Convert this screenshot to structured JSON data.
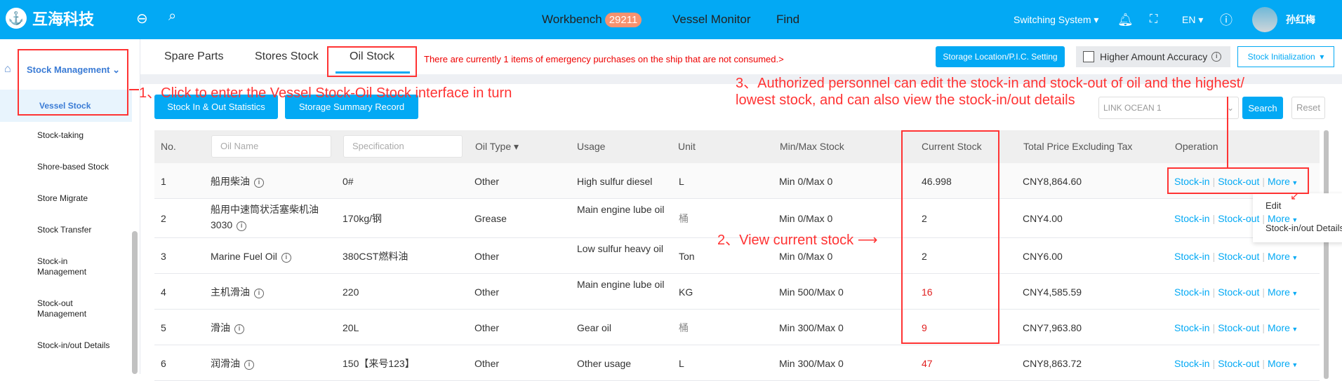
{
  "header": {
    "logo_text": "互海科技",
    "nav": [
      {
        "label": "Workbench",
        "badge": "29211"
      },
      {
        "label": "Vessel Monitor"
      },
      {
        "label": "Find"
      }
    ],
    "switching": "Switching System",
    "lang": "EN",
    "user": "孙红梅"
  },
  "sidebar": {
    "parent": "Stock Management",
    "items": [
      "Vessel Stock",
      "Stock-taking",
      "Shore-based Stock",
      "Store Migrate",
      "Stock Transfer",
      "Stock-in Management",
      "Stock-out Management",
      "Stock-in/out Details"
    ]
  },
  "tabs": [
    "Spare Parts",
    "Stores Stock",
    "Oil Stock"
  ],
  "active_tab": "Oil Stock",
  "notice": "There are currently 1 items of emergency purchases on the ship that are not consumed.>",
  "toolbar": {
    "storage_setting": "Storage Location/P.I.C. Setting",
    "higher_accuracy": "Higher Amount Accuracy",
    "stock_init": "Stock Initialization",
    "stats": "Stock In & Out Statistics",
    "summary": "Storage Summary Record",
    "vessel": "LINK OCEAN 1",
    "search": "Search",
    "reset": "Reset"
  },
  "table": {
    "headers": {
      "no": "No.",
      "oil_name_ph": "Oil Name",
      "spec_ph": "Specification",
      "type": "Oil Type",
      "usage": "Usage",
      "unit": "Unit",
      "minmax": "Min/Max Stock",
      "current": "Current Stock",
      "price": "Total Price Excluding Tax",
      "op": "Operation"
    },
    "rows": [
      {
        "no": "1",
        "name": "船用柴油",
        "spec": "0#",
        "type": "Other",
        "usage": "High sulfur diesel",
        "unit": "L",
        "minmax": "Min 0/Max 0",
        "current": "46.998",
        "low": false,
        "price": "CNY8,864.60"
      },
      {
        "no": "2",
        "name": "船用中速筒状活塞柴机油3030",
        "spec": "170kg/钢",
        "type": "Grease",
        "usage": "Main engine lube oil",
        "unit": "桶",
        "minmax": "Min 0/Max 0",
        "current": "2",
        "low": false,
        "price": "CNY4.00"
      },
      {
        "no": "3",
        "name": "Marine Fuel Oil",
        "spec": "380CST燃料油",
        "type": "Other",
        "usage": "Low sulfur heavy oil",
        "unit": "Ton",
        "minmax": "Min 0/Max 0",
        "current": "2",
        "low": false,
        "price": "CNY6.00"
      },
      {
        "no": "4",
        "name": "主机滑油",
        "spec": "220",
        "type": "Other",
        "usage": "Main engine lube oil",
        "unit": "KG",
        "minmax": "Min 500/Max 0",
        "current": "16",
        "low": true,
        "price": "CNY4,585.59"
      },
      {
        "no": "5",
        "name": "滑油",
        "spec": "20L",
        "type": "Other",
        "usage": "Gear oil",
        "unit": "桶",
        "minmax": "Min 300/Max 0",
        "current": "9",
        "low": true,
        "price": "CNY7,963.80"
      },
      {
        "no": "6",
        "name": "润滑油",
        "spec": "150【来号123】",
        "type": "Other",
        "usage": "Other usage",
        "unit": "L",
        "minmax": "Min 300/Max 0",
        "current": "47",
        "low": true,
        "price": "CNY8,863.72"
      }
    ],
    "ops": {
      "in": "Stock-in",
      "out": "Stock-out",
      "more": "More"
    }
  },
  "dropdown": [
    "Edit",
    "Stock-in/out Details"
  ],
  "annotations": {
    "a1": "1、Click to enter the Vessel Stock-Oil Stock interface in turn",
    "a2": "2、View current stock",
    "a3_line1": "3、Authorized personnel can edit the stock-in and stock-out of oil and the highest/",
    "a3_line2": "lowest stock, and can also view the stock-in/out details"
  },
  "colors": {
    "primary": "#03a9f4",
    "annotation": "#ff3333",
    "low_stock": "#e02020",
    "badge": "#f7926f"
  }
}
